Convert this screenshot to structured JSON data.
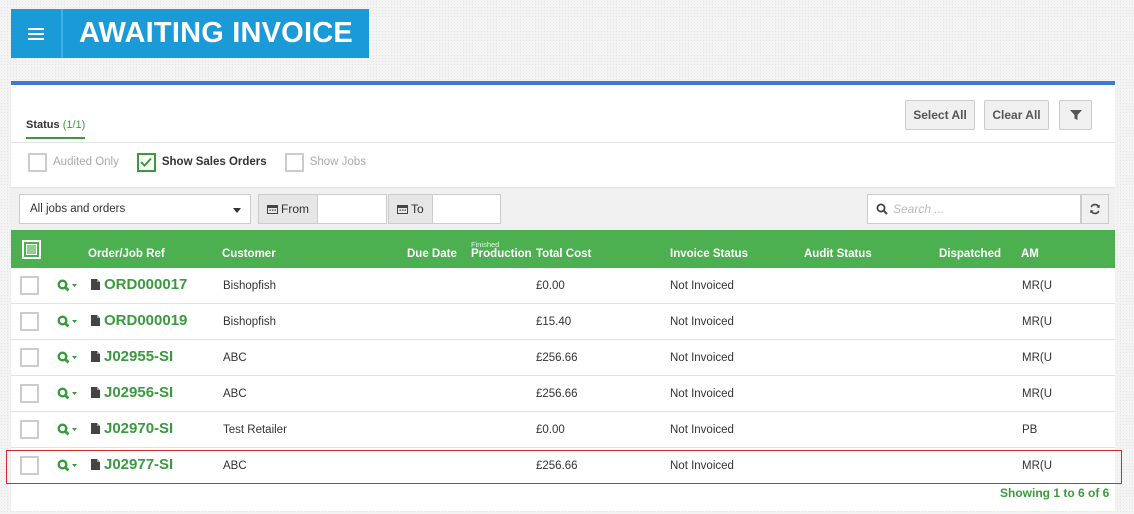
{
  "header": {
    "title": "AWAITING INVOICE"
  },
  "tabs": {
    "status_label": "Status",
    "status_count": "(1/1)"
  },
  "toolbar": {
    "select_all": "Select All",
    "clear_all": "Clear All"
  },
  "checks": {
    "audited_only": "Audited Only",
    "show_sales_orders": "Show Sales Orders",
    "show_jobs": "Show Jobs"
  },
  "filters": {
    "jobs_select": "All jobs and orders",
    "from_label": "From",
    "to_label": "To",
    "search_placeholder": "Search ..."
  },
  "table": {
    "columns": {
      "ref": "Order/Job Ref",
      "customer": "Customer",
      "due_date": "Due Date",
      "production_sub": "Finished",
      "production": "Production",
      "total_cost": "Total Cost",
      "invoice_status": "Invoice Status",
      "audit_status": "Audit Status",
      "dispatched": "Dispatched",
      "am": "AM"
    },
    "rows": [
      {
        "ref": "ORD000017",
        "customer": "Bishopfish",
        "total_cost": "£0.00",
        "invoice_status": "Not Invoiced",
        "am": "MR(U"
      },
      {
        "ref": "ORD000019",
        "customer": "Bishopfish",
        "total_cost": "£15.40",
        "invoice_status": "Not Invoiced",
        "am": "MR(U"
      },
      {
        "ref": "J02955-SI",
        "customer": "ABC",
        "total_cost": "£256.66",
        "invoice_status": "Not Invoiced",
        "am": "MR(U"
      },
      {
        "ref": "J02956-SI",
        "customer": "ABC",
        "total_cost": "£256.66",
        "invoice_status": "Not Invoiced",
        "am": "MR(U"
      },
      {
        "ref": "J02970-SI",
        "customer": "Test Retailer",
        "total_cost": "£0.00",
        "invoice_status": "Not Invoiced",
        "am": "PB"
      },
      {
        "ref": "J02977-SI",
        "customer": "ABC",
        "total_cost": "£256.66",
        "invoice_status": "Not Invoiced",
        "am": "MR(U"
      }
    ]
  },
  "footer": {
    "showing": "Showing 1 to 6 of 6"
  },
  "colors": {
    "accent_green": "#4caf50",
    "header_blue": "#1a9ad6",
    "highlight_red": "#d42a2a"
  }
}
